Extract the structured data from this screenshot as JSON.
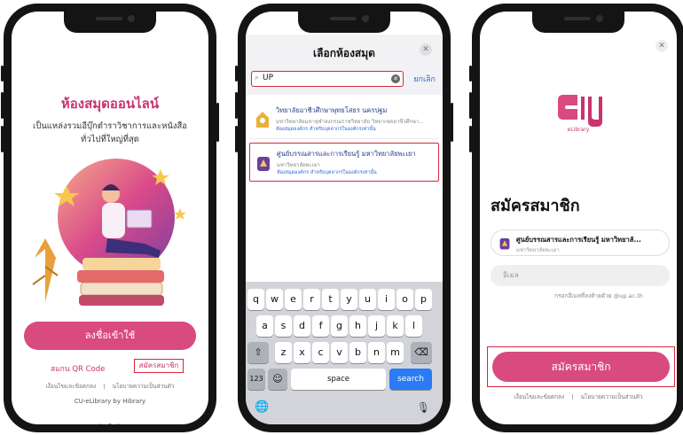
{
  "colors": {
    "brand_pink": "#d94a7f",
    "brand_magenta": "#c8346f",
    "highlight_red": "#d9263c",
    "link_blue": "#2a6bd8"
  },
  "screen1": {
    "title": "ห้องสมุดออนไลน์",
    "description": "เป็นแหล่งรวมอีบุ๊กตำราวิชาการและหนังสือทั่วไปที่ใหญ่ที่สุด",
    "login_button": "ลงชื่อเข้าใช้",
    "scan_qr": "สแกน QR Code",
    "register_link": "สมัครสมาชิก",
    "terms": "เงื่อนไขและข้อตกลง",
    "separator": "|",
    "privacy": "นโยบายความเป็นส่วนตัว",
    "brand": "CU-eLibrary by Hibrary",
    "pager": {
      "total": 3,
      "active": 2
    }
  },
  "screen2": {
    "title": "เลือกห้องสมุด",
    "close_icon": "close-icon",
    "search_query": "UP",
    "cancel": "ยกเลิก",
    "libraries": [
      {
        "name": "วิทยาลัยอาชีวศึกษาพุทธโสธร นครปฐม",
        "sub": "มหาวิทยาลัยมหาจุฬาลงกรณราชวิทยาลัย วิทยาเขตอาชีวศึกษา...",
        "tag": "ห้องสมุดองค์กร สำหรับบุคลากรในองค์กรเท่านั้น"
      },
      {
        "name": "ศูนย์บรรณสารและการเรียนรู้ มหาวิทยาลัยพะเยา",
        "sub": "มหาวิทยาลัยพะเยา",
        "tag": "ห้องสมุดองค์กร สำหรับบุคลากรในองค์กรเท่านั้น"
      }
    ],
    "keyboard": {
      "row1": [
        "q",
        "w",
        "e",
        "r",
        "t",
        "y",
        "u",
        "i",
        "o",
        "p"
      ],
      "row2": [
        "a",
        "s",
        "d",
        "f",
        "g",
        "h",
        "j",
        "k",
        "l"
      ],
      "row3": [
        "z",
        "x",
        "c",
        "v",
        "b",
        "n",
        "m"
      ],
      "shift": "⇧",
      "backspace": "⌫",
      "numbers": "123",
      "emoji": "☺",
      "space": "space",
      "search": "search",
      "globe": "🌐",
      "mic": "🎙"
    }
  },
  "screen3": {
    "logo_text": "eLibrary",
    "title": "สมัครสมาชิก",
    "library_name": "ศูนย์บรรณสารและการเรียนรู้ มหาวิทยาลั...",
    "library_sub": "มหาวิทยาลัยพะเยา",
    "email_placeholder": "อีเมล",
    "email_hint": "กรอกอีเมลที่ลงท้ายด้วย @up.ac.th",
    "register_button": "สมัครสมาชิก",
    "terms": "เงื่อนไขและข้อตกลง",
    "separator": "|",
    "privacy": "นโยบายความเป็นส่วนตัว"
  }
}
